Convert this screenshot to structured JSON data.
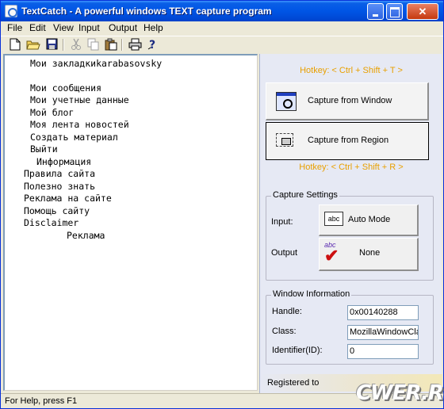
{
  "window": {
    "title": "TextCatch - A powerful windows TEXT capture program"
  },
  "menu": [
    "File",
    "Edit",
    "View",
    "Input",
    "Output",
    "Help"
  ],
  "toolbar": {
    "new_icon": "new-file-icon",
    "open_icon": "open-folder-icon",
    "save_icon": "save-icon",
    "cut_icon": "cut-icon",
    "copy_icon": "copy-icon",
    "paste_icon": "paste-icon",
    "print_icon": "print-icon",
    "help_icon": "help-icon"
  },
  "text_lines": [
    "Мои закладкиkarabasovsky",
    "",
    "Мои сообщения",
    "Мои учетные данные",
    "Мой блог",
    "Моя лента новостей",
    "Создать материал",
    "Выйти",
    "Информация",
    "Правила сайта",
    "Полезно знать",
    "Реклама на сайте",
    "Помощь сайту",
    "Disclaimer",
    "Реклама"
  ],
  "capture": {
    "hotkey_window": "Hotkey: < Ctrl + Shift + T >",
    "capture_window_label": "Capture from Window",
    "capture_region_label": "Capture from Region",
    "hotkey_region": "Hotkey: < Ctrl + Shift + R >"
  },
  "settings": {
    "title": "Capture Settings",
    "input_label": "Input:",
    "input_value": "Auto Mode",
    "output_label": "Output",
    "output_value": "None"
  },
  "window_info": {
    "title": "Window Information",
    "handle_label": "Handle:",
    "handle_value": "0x00140288",
    "class_label": "Class:",
    "class_value": "MozillaWindowCla",
    "identifier_label": "Identifier(ID):",
    "identifier_value": "0"
  },
  "registered": "Registered to",
  "status": "For Help, press F1",
  "watermark": "CWER.RU",
  "colors": {
    "titlebar": "#0055e5",
    "hotkey": "#e8a000",
    "panel": "#e6e9f4"
  }
}
